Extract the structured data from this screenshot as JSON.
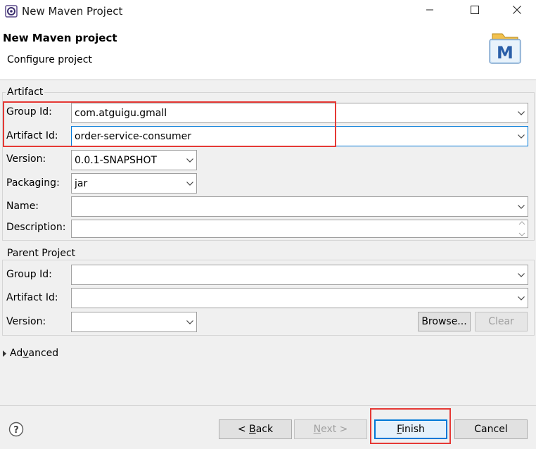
{
  "window": {
    "title": "New Maven Project",
    "icons": {
      "app": "eclipse-icon",
      "minimize": "minimize-icon",
      "maximize": "maximize-icon",
      "close": "close-icon"
    }
  },
  "header": {
    "title": "New Maven project",
    "subtitle": "Configure project",
    "logo_letter": "M"
  },
  "artifact": {
    "legend": "Artifact",
    "group_id": {
      "label": "Group Id:",
      "value": "com.atguigu.gmall"
    },
    "artifact_id": {
      "label": "Artifact Id:",
      "value": "order-service-consumer"
    },
    "version": {
      "label": "Version:",
      "value": "0.0.1-SNAPSHOT"
    },
    "packaging": {
      "label": "Packaging:",
      "value": "jar"
    },
    "name": {
      "label": "Name:",
      "value": ""
    },
    "description": {
      "label": "Description:",
      "value": ""
    }
  },
  "parent": {
    "legend": "Parent Project",
    "group_id": {
      "label": "Group Id:",
      "value": ""
    },
    "artifact_id": {
      "label": "Artifact Id:",
      "value": ""
    },
    "version": {
      "label": "Version:",
      "value": ""
    },
    "browse": "Browse...",
    "clear": "Clear"
  },
  "advanced": {
    "label_pre": "Ad",
    "label_mnemonic": "v",
    "label_post": "anced"
  },
  "footer": {
    "back": {
      "pre": "< ",
      "mnemonic": "B",
      "post": "ack"
    },
    "next": {
      "mnemonic": "N",
      "post": "ext >"
    },
    "finish": {
      "mnemonic": "F",
      "post": "inish"
    },
    "cancel": "Cancel"
  },
  "colors": {
    "highlight": "#e53935",
    "focus": "#0078d7",
    "window_bg": "#f0f0f0"
  }
}
